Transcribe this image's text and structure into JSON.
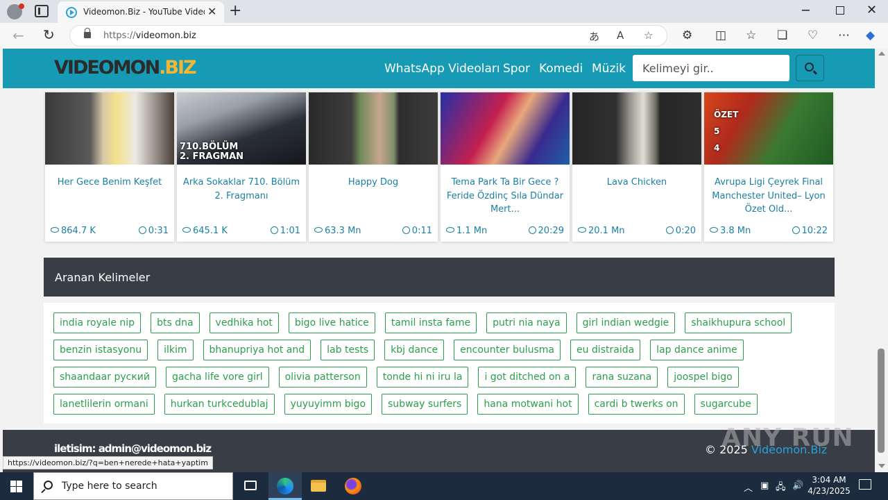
{
  "browser": {
    "tab_title": "Videomon.Biz - YouTube Video D",
    "tab_close": "✕",
    "new_tab": "+",
    "url_scheme": "https://",
    "url_host": "videomon.biz",
    "status_url": "https://videomon.biz/?q=ben+nerede+hata+yaptim"
  },
  "site": {
    "logo_main": "VIDEOMON",
    "logo_ext": ".BIZ",
    "menu": [
      "WhatsApp Videoları",
      "Spor",
      "Komedi",
      "Müzik"
    ],
    "search_placeholder": "Kelimeyi gir.."
  },
  "videos": [
    {
      "title": "Her Gece Benim Keşfet",
      "views": "864.7 K",
      "duration": "0:31",
      "thumb_text": "",
      "bg": "linear-gradient(90deg,#3a3a3a 0%,#5a5a5a 35%,#d9c8a8 45%,#f4e18a 55%,#ece9e4 70%,#4a3e36 100%)"
    },
    {
      "title": "Arka Sokaklar 710. Bölüm 2. Fragmanı",
      "views": "645.1 K",
      "duration": "1:01",
      "thumb_text": "710.BÖLÜM\n2. FRAGMAN",
      "bg": "linear-gradient(160deg,#c9cbcf 0%,#9aa0a8 30%,#2b2f38 60%,#15171c 100%)"
    },
    {
      "title": "Happy Dog",
      "views": "63.3 Mn",
      "duration": "0:11",
      "thumb_text": "",
      "bg": "linear-gradient(90deg,#2a2a2a 0%,#3d3d3d 33%,#6f8a5a 40%,#c8a68d 55%,#7c8f6a 66%,#2e2e2e 70%,#3b3b3b 100%)"
    },
    {
      "title": "Tema Park Ta Bir Gece ? Feride Özdinç Sıla Dündar Mert...",
      "views": "1.1 Mn",
      "duration": "20:29",
      "thumb_text": "",
      "bg": "linear-gradient(120deg,#2330a8 0%,#c41f4f 40%,#e8a87c 55%,#3a2a8f 75%,#1e5fa8 100%)"
    },
    {
      "title": "Lava Chicken",
      "views": "20.1 Mn",
      "duration": "0:20",
      "thumb_text": "",
      "bg": "linear-gradient(90deg,#262626 0%,#303030 34%,#9a9890 45%,#e2ded6 55%,#6b6861 65%,#262626 68%,#2e2e2e 100%)"
    },
    {
      "title": "Avrupa Ligi Çeyrek Final Manchester United– Lyon Özet Old...",
      "views": "3.8 Mn",
      "duration": "10:22",
      "thumb_text": "ÖZET\n5\n4",
      "bg": "linear-gradient(120deg,#d5471c 0%,#b02a1c 30%,#3a7a32 60%,#1f5a22 100%)"
    }
  ],
  "keywords": {
    "title": "Aranan Kelimeler",
    "rows": [
      [
        "india royale nip",
        "bts dna",
        "vedhika hot",
        "bigo live hatice",
        "tamil insta fame",
        "putri nia naya",
        "girl indian wedgie",
        "shaikhupura school"
      ],
      [
        "benzin istasyonu",
        "ilkim",
        "bhanupriya hot and",
        "lab tests",
        "kbj dance",
        "encounter bulusma",
        "eu distraida",
        "lap dance anime"
      ],
      [
        "shaandaar руский",
        "gacha life vore girl",
        "olivia patterson",
        "tonde hi ni iru la",
        "i got ditched on a",
        "rana suzana",
        "joospel bigo"
      ],
      [
        "lanetlilerin ormani",
        "hurkan turkcedublaj",
        "yuyuyimm bigo",
        "subway surfers",
        "hana motwani hot",
        "cardi b twerks on",
        "sugarcube"
      ]
    ]
  },
  "footer": {
    "contact": "iletisim: admin@videomon.biz",
    "copyright_prefix": "© 2025",
    "copyright_brand": "Videomon.Biz",
    "watermark": "ANY RUN"
  },
  "taskbar": {
    "search_placeholder": "Type here to search",
    "time": "3:04 AM",
    "date": "4/23/2025"
  },
  "colors": {
    "header": "#179bb5",
    "link": "#1a7fa3",
    "tag": "#2c9e4b",
    "dark_panel": "#393e46"
  }
}
